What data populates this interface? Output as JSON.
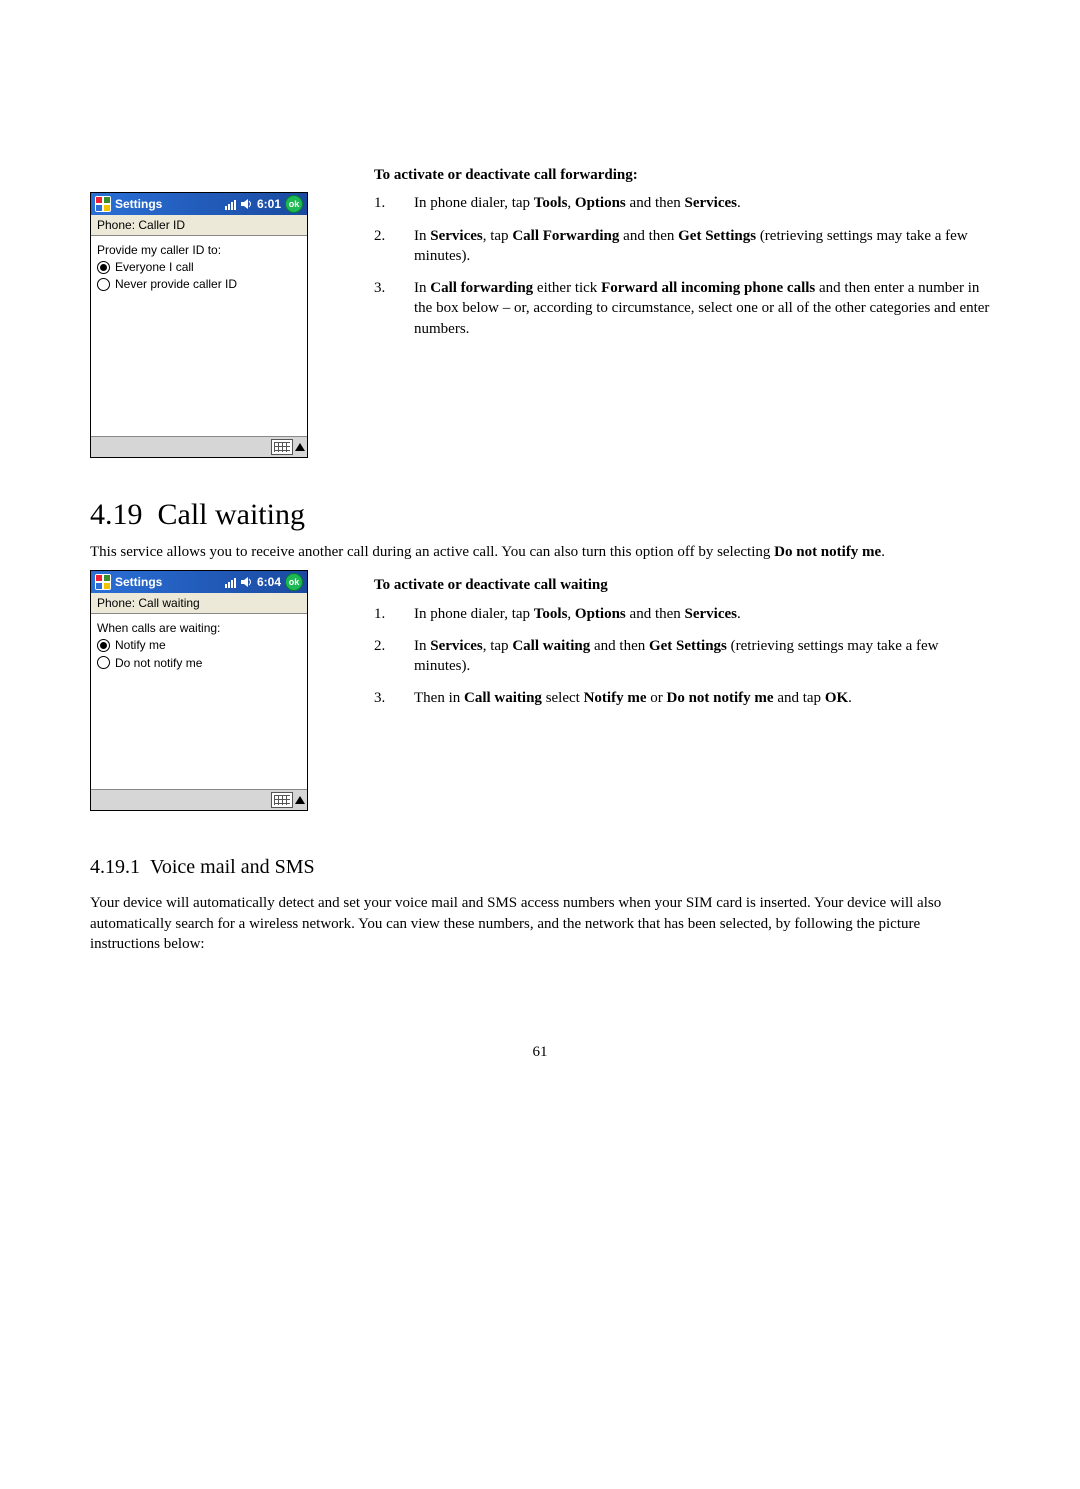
{
  "section1": {
    "heading": "To activate or deactivate call forwarding:",
    "steps": [
      {
        "num": "1.",
        "pre": "In phone dialer, tap ",
        "b1": "Tools",
        "mid1": ", ",
        "b2": "Options",
        "mid2": " and then ",
        "b3": "Services",
        "post": "."
      },
      {
        "num": "2.",
        "pre": "In ",
        "b1": "Services",
        "mid1": ", tap ",
        "b2": "Call Forwarding",
        "mid2": " and then ",
        "b3": "Get Settings",
        "post": " (retrieving settings may take a few minutes)."
      },
      {
        "num": "3.",
        "pre": "In ",
        "b1": "Call forwarding",
        "mid1": " either tick ",
        "b2": "Forward all incoming phone calls",
        "mid2": " and then enter a number in the box below – or, according to circumstance, select one or all of the other categories and enter numbers.",
        "b3": "",
        "post": ""
      }
    ],
    "device": {
      "title": "Settings",
      "time": "6:01",
      "ok": "ok",
      "subtitle": "Phone: Caller ID",
      "label": "Provide my caller ID to:",
      "opt1": "Everyone I call",
      "opt2": "Never provide caller ID"
    }
  },
  "section2": {
    "number": "4.19",
    "title": "Call waiting",
    "intro_pre": "This service allows you to receive another call during an active call. You can also turn this option off by selecting ",
    "intro_b": "Do not notify me",
    "intro_post": ".",
    "heading": "To activate or deactivate call waiting",
    "steps": [
      {
        "num": "1.",
        "pre": "In phone dialer, tap ",
        "b1": "Tools",
        "mid1": ", ",
        "b2": "Options",
        "mid2": " and then ",
        "b3": "Services",
        "post": "."
      },
      {
        "num": "2.",
        "pre": "In ",
        "b1": "Services",
        "mid1": ", tap ",
        "b2": "Call waiting",
        "mid2": " and then ",
        "b3": "Get Settings",
        "post": " (retrieving settings may take a few minutes)."
      },
      {
        "num": "3.",
        "pre": "Then in ",
        "b1": "Call waiting",
        "mid1": " select ",
        "b2": "Notify me",
        "mid2": " or ",
        "b3": "Do not notify me",
        "post": " and tap ",
        "b4": "OK",
        "post2": "."
      }
    ],
    "device": {
      "title": "Settings",
      "time": "6:04",
      "ok": "ok",
      "subtitle": "Phone: Call waiting",
      "label": "When calls are waiting:",
      "opt1": "Notify me",
      "opt2": "Do not notify me"
    }
  },
  "section3": {
    "number": "4.19.1",
    "title": "Voice mail and SMS",
    "para": "Your device will automatically detect and set your voice mail and SMS access numbers when your SIM card is inserted.  Your device will also automatically search for a wireless network.  You can view these numbers, and the network that has been selected, by following the picture instructions below:"
  },
  "page_number": "61"
}
